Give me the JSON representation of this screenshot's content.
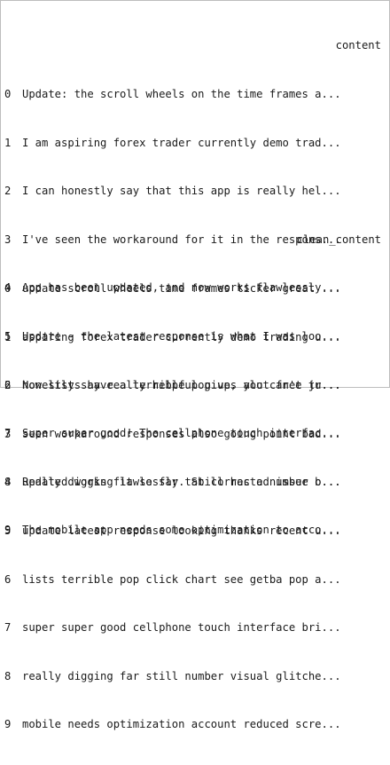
{
  "series_content": {
    "header": "content",
    "rows": [
      {
        "index": "0",
        "text": "Update: the scroll wheels on the time frames a..."
      },
      {
        "index": "1",
        "text": "I am aspiring forex trader currently demo trad..."
      },
      {
        "index": "2",
        "text": "I can honestly say that this app is really hel..."
      },
      {
        "index": "3",
        "text": "I've seen the workaround for it in the respons..."
      },
      {
        "index": "4",
        "text": "App has been updated, and now works flawlessly..."
      },
      {
        "index": "5",
        "text": "Update - the latest response is what I was loo..."
      },
      {
        "index": "6",
        "text": "Now lists have a terrible pop up, you can't ju..."
      },
      {
        "index": "7",
        "text": "Super super good! The cellphone touch interfac..."
      },
      {
        "index": "8",
        "text": "Really digging it so far. Still has a number o..."
      },
      {
        "index": "9",
        "text": "The mobile app needs some optimization to acco..."
      }
    ]
  },
  "series_clean": {
    "header": "clean_content",
    "rows": [
      {
        "index": "0",
        "text": "update scroll wheels time frames ticker great ..."
      },
      {
        "index": "1",
        "text": "aspiring forex trader currently demo trading u..."
      },
      {
        "index": "2",
        "text": "honestly say really helpful gives alot free tr..."
      },
      {
        "index": "3",
        "text": "seen workaround responses also going point bad..."
      },
      {
        "index": "4",
        "text": "updated works flawlessly tab corrected issue b..."
      },
      {
        "index": "5",
        "text": "update latest response looking thanks recent u..."
      },
      {
        "index": "6",
        "text": "lists terrible pop click chart see getba pop a..."
      },
      {
        "index": "7",
        "text": "super super good cellphone touch interface bri..."
      },
      {
        "index": "8",
        "text": "really digging far still number visual glitche..."
      },
      {
        "index": "9",
        "text": "mobile needs optimization account reduced scre..."
      }
    ]
  }
}
